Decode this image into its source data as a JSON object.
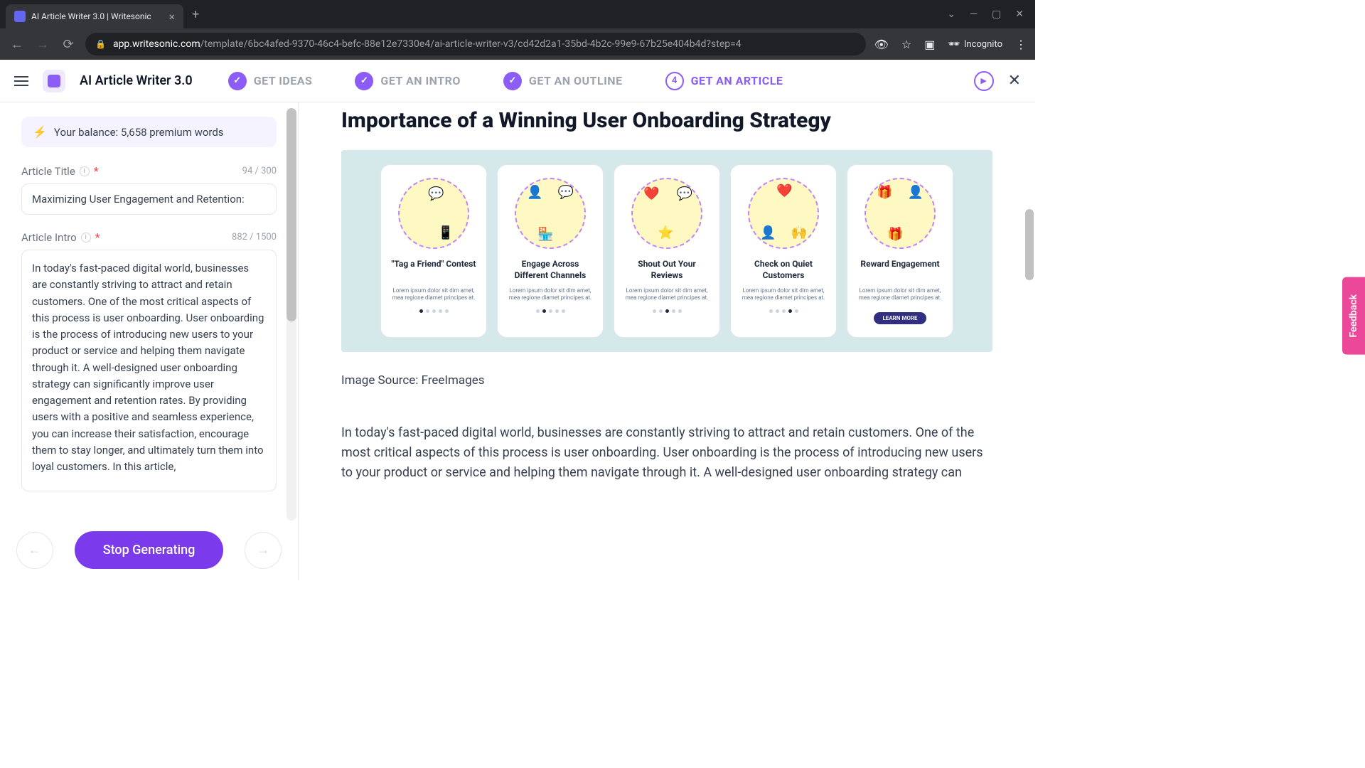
{
  "browser": {
    "tab_title": "AI Article Writer 3.0 | Writesonic",
    "url_domain": "app.writesonic.com",
    "url_path": "/template/6bc4afed-9370-46c4-befc-88e12e7330e4/ai-article-writer-v3/cd42d2a1-35bd-4b2c-99e9-67b25e404b4d?step=4",
    "incognito": "Incognito"
  },
  "header": {
    "app_title": "AI Article Writer 3.0",
    "steps": [
      {
        "label": "GET IDEAS",
        "state": "done"
      },
      {
        "label": "GET AN INTRO",
        "state": "done"
      },
      {
        "label": "GET AN OUTLINE",
        "state": "done"
      },
      {
        "label": "GET AN ARTICLE",
        "state": "active",
        "num": "4"
      }
    ]
  },
  "sidebar": {
    "balance": "Your balance: 5,658 premium words",
    "title_label": "Article Title",
    "title_count": "94 / 300",
    "title_value": "Maximizing User Engagement and Retention:",
    "intro_label": "Article Intro",
    "intro_count": "882 / 1500",
    "intro_value": "In today's fast-paced digital world, businesses are constantly striving to attract and retain customers. One of the most critical aspects of this process is user onboarding. User onboarding is the process of introducing new users to your product or service and helping them navigate through it. A well-designed user onboarding strategy can significantly improve user engagement and retention rates. By providing users with a positive and seamless experience, you can increase their satisfaction, encourage them to stay longer, and ultimately turn them into loyal customers. In this article,",
    "stop_button": "Stop Generating"
  },
  "article": {
    "title": "Importance of a Winning User Onboarding Strategy",
    "image_source": "Image Source: FreeImages",
    "body": "In today's fast-paced digital world, businesses are constantly striving to attract and retain customers. One of the most critical aspects of this process is user onboarding. User onboarding is the process of introducing new users to your product or service and helping them navigate through it. A well-designed user onboarding strategy can",
    "cards": [
      {
        "title": "\"Tag a Friend\" Contest",
        "text": "Lorem ipsum dolor sit dim amet, mea regione diamet principes at.",
        "active_dot": 0
      },
      {
        "title": "Engage Across Different Channels",
        "text": "Lorem ipsum dolor sit dim amet, mea regione diamet principes at.",
        "active_dot": 1
      },
      {
        "title": "Shout Out Your Reviews",
        "text": "Lorem ipsum dolor sit dim amet, mea regione diamet principes at.",
        "active_dot": 2
      },
      {
        "title": "Check on Quiet Customers",
        "text": "Lorem ipsum dolor sit dim amet, mea regione diamet principes at.",
        "active_dot": 3
      },
      {
        "title": "Reward Engagement",
        "text": "Lorem ipsum dolor sit dim amet, mea regione diamet principes at.",
        "learn": "LEARN MORE"
      }
    ]
  },
  "feedback": "Feedback"
}
